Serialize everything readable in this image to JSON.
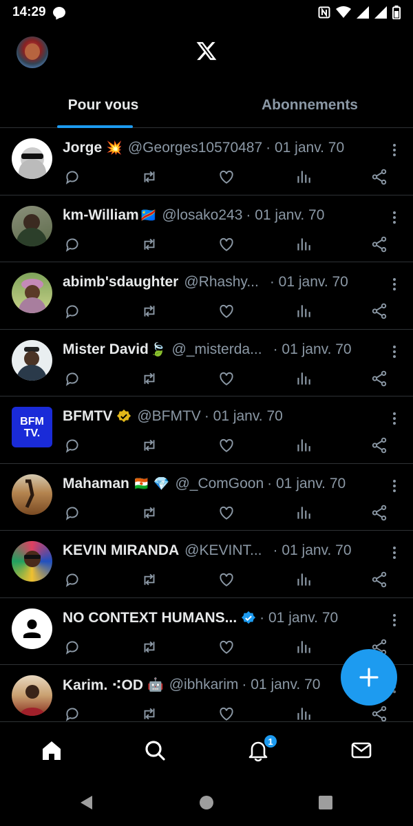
{
  "status_bar": {
    "time": "14:29"
  },
  "header": {
    "logo": "x-logo-icon"
  },
  "tabs": [
    {
      "label": "Pour vous",
      "active": true
    },
    {
      "label": "Abonnements",
      "active": false
    }
  ],
  "tweets": [
    {
      "name": "Jorge",
      "emoji": "💥",
      "handle": "@Georges10570487",
      "date": "· 01 janv. 70"
    },
    {
      "name": "km-William",
      "emoji": "🇨🇩",
      "handle": "@losako243",
      "date": "· 01 janv. 70"
    },
    {
      "name": "abimb'sdaughter",
      "emoji": "",
      "handle": "@Rhashy...",
      "date": "· 01 janv. 70"
    },
    {
      "name": "Mister David",
      "emoji": "🍃",
      "handle": "@_misterda...",
      "date": "· 01 janv. 70"
    },
    {
      "name": "BFMTV",
      "emoji": "",
      "handle": "@BFMTV",
      "date": "· 01 janv. 70",
      "avatar_text": "BFM TV."
    },
    {
      "name": "Mahaman",
      "emoji": "🇳🇪 💎",
      "handle": "@_ComGoon",
      "date": "· 01 janv. 70"
    },
    {
      "name": "KEVIN MIRANDA",
      "emoji": "",
      "handle": "@KEVINT...",
      "date": "· 01 janv. 70"
    },
    {
      "name": "NO CONTEXT HUMANS...",
      "emoji": "",
      "handle": "",
      "date": "· 01 janv. 70"
    },
    {
      "name": "Karim. ⁖OD",
      "emoji": "🤖",
      "handle": "@ibhkarim",
      "date": "· 01 janv. 70"
    }
  ],
  "bottom_nav": {
    "notifications_badge": "1"
  },
  "colors": {
    "accent": "#1d9bf0",
    "background": "#000000",
    "muted": "#8b98a5",
    "divider": "#2f3336"
  }
}
